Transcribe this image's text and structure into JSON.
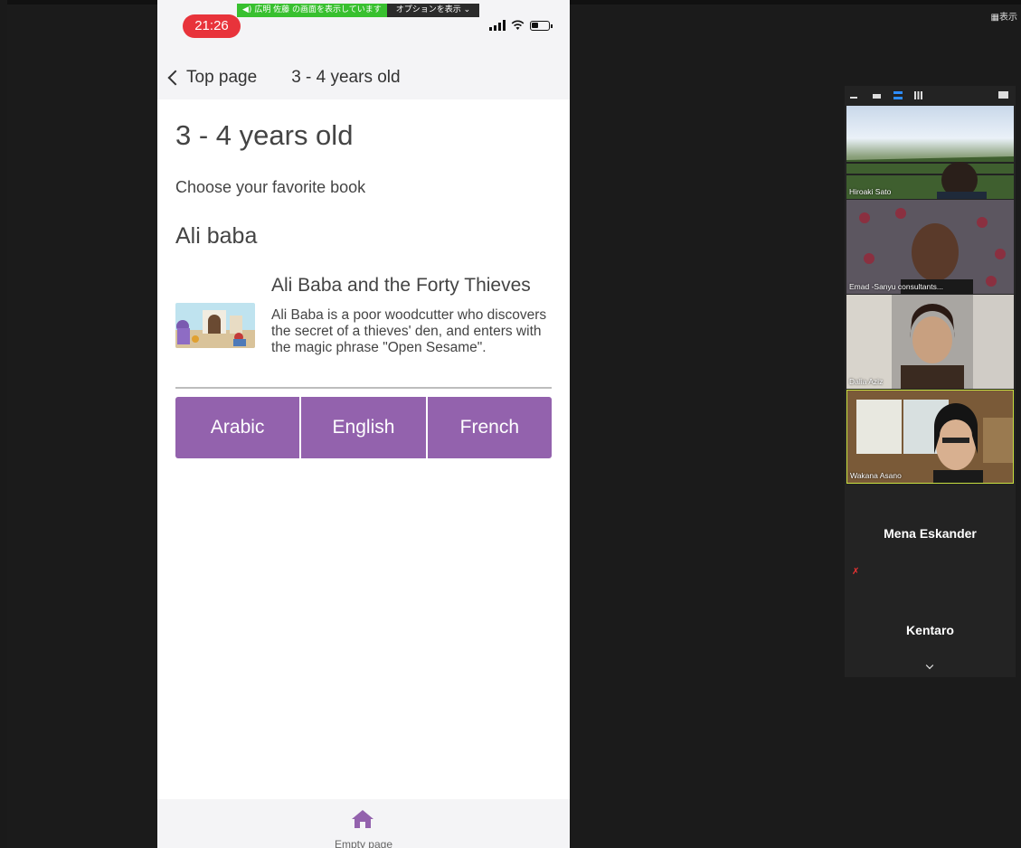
{
  "zoom": {
    "view_label": "表示",
    "share_banner": {
      "sharing_text": "広明 佐藤 の画面を表示しています",
      "options_label": "オプションを表示"
    }
  },
  "phone": {
    "status": {
      "time": "21:26"
    },
    "nav": {
      "back_label": "Top page",
      "title": "3 - 4 years old"
    },
    "content": {
      "title": "3 - 4 years old",
      "subtitle": "Choose your favorite book",
      "section": "Ali baba",
      "book": {
        "name": "Ali Baba and the Forty Thieves",
        "description": "Ali Baba is a poor woodcutter who discovers the secret of a thieves' den, and enters with the magic phrase \"Open Sesame\"."
      },
      "languages": [
        "Arabic",
        "English",
        "French"
      ],
      "accent_color": "#9362ad"
    },
    "tab_bar": {
      "label": "Empty page",
      "icon": "home-icon"
    }
  },
  "gallery": {
    "participants": [
      {
        "name": "Hiroaki Sato"
      },
      {
        "name": "Emad -Sanyu consultants..."
      },
      {
        "name": "Dalia Aziz"
      },
      {
        "name": "Wakana Asano"
      }
    ],
    "text_participants": [
      {
        "name": "Mena Eskander"
      },
      {
        "name": "Kentaro"
      }
    ]
  }
}
